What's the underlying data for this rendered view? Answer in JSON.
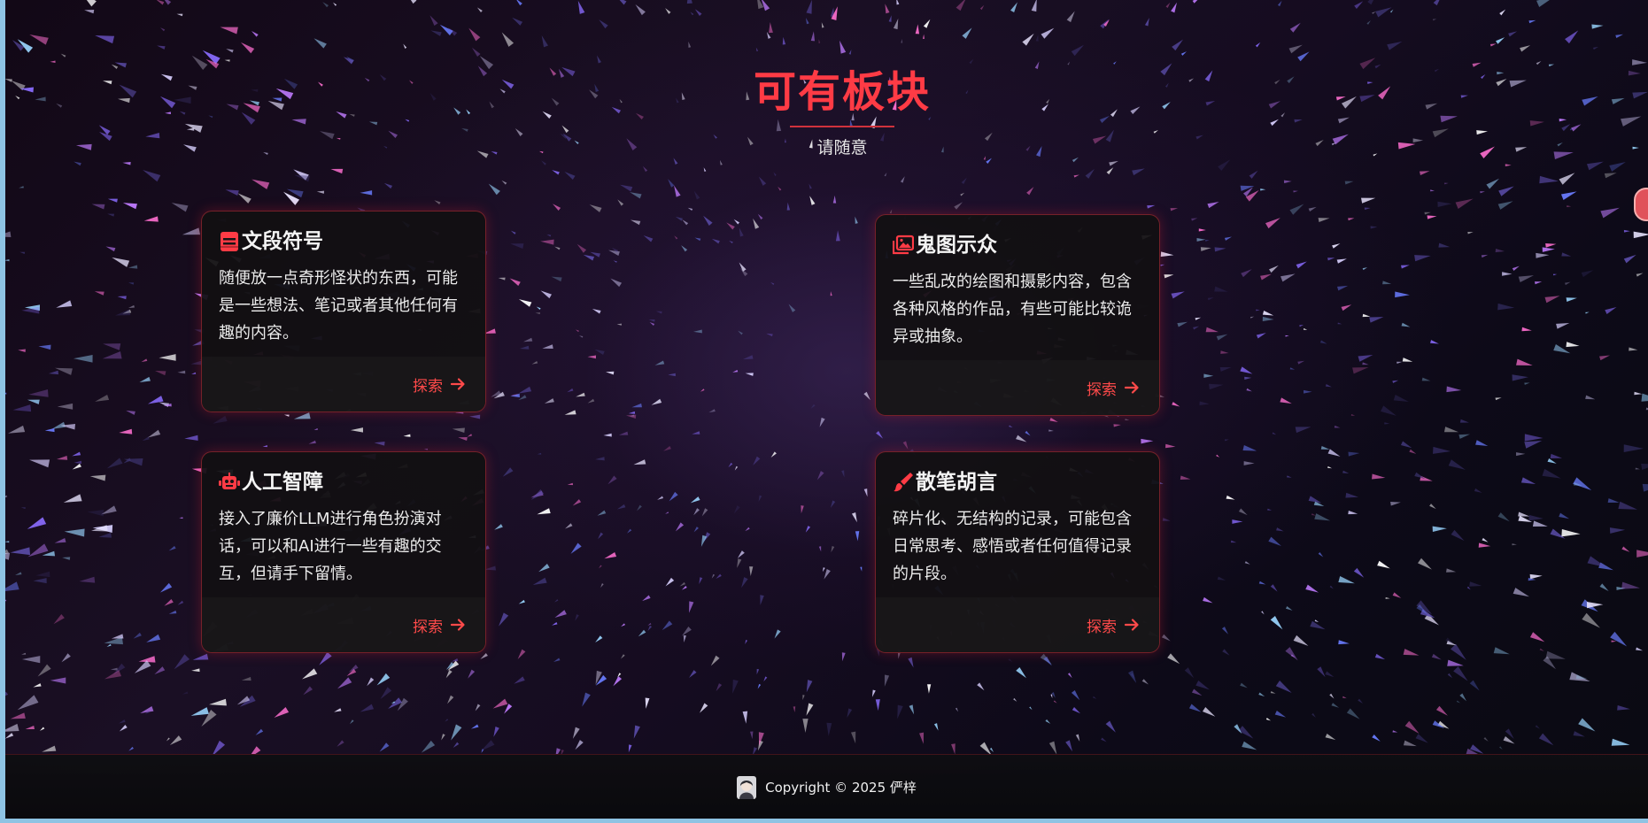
{
  "header": {
    "title": "可有板块",
    "subtitle": "请随意"
  },
  "cards": [
    {
      "icon": "notebook-icon",
      "title": "文段符号",
      "description": "随便放一点奇形怪状的东西，可能是一些想法、笔记或者其他任何有趣的内容。",
      "link_label": "探索"
    },
    {
      "icon": "gallery-icon",
      "title": "鬼图示众",
      "description": "一些乱改的绘图和摄影内容，包含各种风格的作品，有些可能比较诡异或抽象。",
      "link_label": "探索"
    },
    {
      "icon": "robot-icon",
      "title": "人工智障",
      "description": "接入了廉价LLM进行角色扮演对话，可以和AI进行一些有趣的交互，但请手下留情。",
      "link_label": "探索"
    },
    {
      "icon": "paintbrush-icon",
      "title": "散笔胡言",
      "description": "碎片化、无结构的记录，可能包含日常思考、感悟或者任何值得记录的片段。",
      "link_label": "探索"
    }
  ],
  "footer": {
    "copyright": "Copyright © 2025 俨梓"
  },
  "colors": {
    "accent": "#ff3b45",
    "card_border": "#c8323c",
    "background": "#120c1a"
  }
}
